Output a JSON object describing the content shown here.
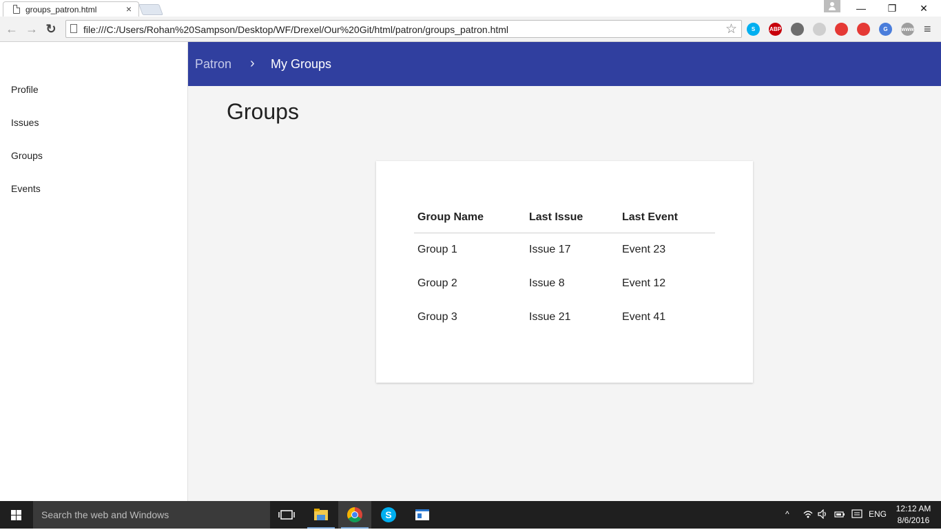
{
  "browser": {
    "tab_title": "groups_patron.html",
    "tab_close": "×",
    "url": "file:///C:/Users/Rohan%20Sampson/Desktop/WF/Drexel/Our%20Git/html/patron/groups_patron.html",
    "minimize": "—",
    "restore": "❐",
    "close": "✕",
    "back": "←",
    "forward": "→",
    "reload": "↻",
    "star": "☆",
    "menu": "≡",
    "extensions": [
      {
        "name": "skype-extension-icon",
        "label": "S",
        "color": "#00aff0"
      },
      {
        "name": "adblock-plus-icon",
        "label": "ABP",
        "color": "#c7000b"
      },
      {
        "name": "bulb-extension-icon",
        "label": "",
        "color": "#6d6d6d"
      },
      {
        "name": "refresh-extension-icon",
        "label": "",
        "color": "#cfcfcf"
      },
      {
        "name": "no-script-extension-icon",
        "label": "",
        "color": "#e53935"
      },
      {
        "name": "target-extension-icon",
        "label": "",
        "color": "#e53935"
      },
      {
        "name": "google-translate-icon",
        "label": "G",
        "color": "#4a7ddb"
      },
      {
        "name": "www-extension-icon",
        "label": "www",
        "color": "#9e9e9e"
      }
    ]
  },
  "sidebar": {
    "items": [
      "Profile",
      "Issues",
      "Groups",
      "Events"
    ]
  },
  "header": {
    "breadcrumb_root": "Patron",
    "separator": "›",
    "breadcrumb_current": "My Groups"
  },
  "main": {
    "title": "Groups",
    "table": {
      "columns": [
        "Group Name",
        "Last Issue",
        "Last Event"
      ],
      "rows": [
        [
          "Group 1",
          "Issue 17",
          "Event 23"
        ],
        [
          "Group 2",
          "Issue 8",
          "Event 12"
        ],
        [
          "Group 3",
          "Issue 21",
          "Event 41"
        ]
      ]
    }
  },
  "taskbar": {
    "search_placeholder": "Search the web and Windows",
    "language": "ENG",
    "time": "12:12 AM",
    "date": "8/6/2016",
    "tray_up": "^"
  }
}
